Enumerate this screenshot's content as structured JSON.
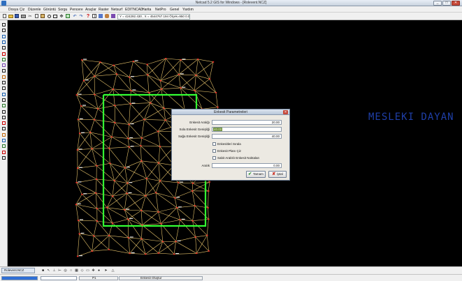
{
  "window": {
    "title": "Netcad 5.2 GIS for Windows - [Rolevent.NCZ]",
    "minimize": "_",
    "maximize": "□",
    "close": "✕"
  },
  "menu": [
    "Dosya",
    "Çiz",
    "Düzenle",
    "Görüntü",
    "Sorgu",
    "Pencere",
    "Araçlar",
    "Raster",
    "Netsurf",
    "EDITNCAD",
    "Harita",
    "NetPro",
    "Genel",
    "Yardım"
  ],
  "toolbar": {
    "coordinates": "Y = 424292.430 , X = 4544767.194  Ölçek=950   0.01s"
  },
  "canvas": {
    "side_text": "MESLEKI DAYAN",
    "colors": {
      "background": "#000000",
      "tin": "#e6c36b",
      "points": "#ff2a2a",
      "boundary": "#33ff33",
      "side_text": "#1f3fa8"
    }
  },
  "dialog": {
    "title": "Enkesit Parametreleri",
    "close": "✕",
    "fields": [
      {
        "label": "Enkesit Aralığı",
        "value": "20.00"
      },
      {
        "label": "Sola Enkesit Genişliği",
        "value": "40.00"
      },
      {
        "label": "Sağa Enkesit Genişliği",
        "value": "40.00"
      }
    ],
    "checkboxes": [
      {
        "label": "Enkesitleri Sırala",
        "checked": false
      },
      {
        "label": "Enkesit Planı Çiz",
        "checked": false
      },
      {
        "label": "Sabit Aralıklı Enkesit Noktaları",
        "checked": false
      }
    ],
    "aralik_label": "Aralık",
    "aralik_value": "0.00",
    "ok_label": "Tamam",
    "cancel_label": "İptal"
  },
  "bottom": {
    "drawing_tab": "Rolevent.NCZ",
    "status_p": "P1",
    "status_message": "Enkesit Oluştur",
    "progress_percent": 100
  }
}
